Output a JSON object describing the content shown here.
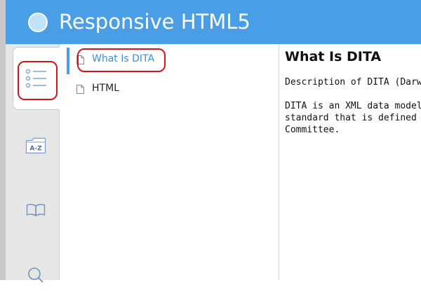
{
  "header": {
    "title": "Responsive HTML5"
  },
  "sidebar": {
    "tabs": [
      {
        "id": "contents",
        "icon": "list-icon",
        "active": true
      },
      {
        "id": "index",
        "icon": "a-z-folder-icon",
        "label": "A-Z"
      },
      {
        "id": "glossary",
        "icon": "book-icon"
      },
      {
        "id": "search",
        "icon": "search-icon"
      }
    ]
  },
  "toc": {
    "items": [
      {
        "label": "What Is DITA",
        "selected": true,
        "icon": "document-icon"
      },
      {
        "label": "HTML",
        "selected": false,
        "icon": "document-icon"
      }
    ]
  },
  "content": {
    "title": "What Is DITA",
    "line1": "Description of DITA (Darwin",
    "line2": "DITA is an XML data model f",
    "line3": "standard that is defined and",
    "line4": "Committee."
  },
  "colors": {
    "header": "#4a9ee6",
    "accent": "#3a8fd9",
    "highlight": "#d3151c"
  }
}
